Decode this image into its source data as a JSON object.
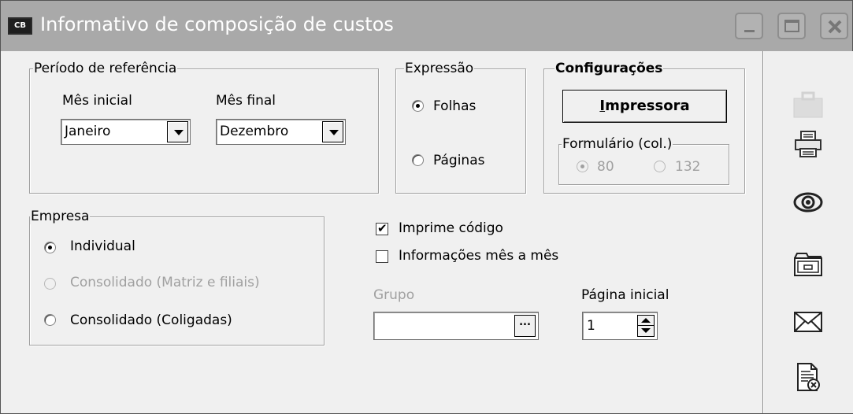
{
  "window": {
    "icon_text": "CB",
    "title": "Informativo de composição de custos"
  },
  "periodo": {
    "legend": "Período de referência",
    "mes_inicial_label": "Mês inicial",
    "mes_inicial_value": "Janeiro",
    "mes_final_label": "Mês final",
    "mes_final_value": "Dezembro"
  },
  "expressao": {
    "legend": "Expressão",
    "options": [
      {
        "label": "Folhas",
        "selected": true
      },
      {
        "label": "Páginas",
        "selected": false
      }
    ]
  },
  "configuracoes": {
    "legend": "Configurações",
    "printer_button_label": "Impressora",
    "printer_button_accel": "I",
    "printer_button_rest": "mpressora",
    "formulario": {
      "legend": "Formulário (col.)",
      "options": [
        {
          "label": "80",
          "selected": true,
          "enabled": false
        },
        {
          "label": "132",
          "selected": false,
          "enabled": false
        }
      ]
    }
  },
  "empresa": {
    "legend": "Empresa",
    "options": [
      {
        "label": "Individual",
        "selected": true,
        "enabled": true
      },
      {
        "label": "Consolidado (Matriz e filiais)",
        "selected": false,
        "enabled": false
      },
      {
        "label": "Consolidado (Coligadas)",
        "selected": false,
        "enabled": true
      }
    ]
  },
  "options": {
    "imprime_codigo": {
      "label": "Imprime código",
      "checked": true
    },
    "informacoes_mes": {
      "label": "Informações mês a mês",
      "checked": false
    }
  },
  "grupo": {
    "label": "Grupo",
    "value": "",
    "browse_label": "..."
  },
  "pagina_inicial": {
    "label": "Página inicial",
    "value": "1"
  },
  "sidebar": {
    "icons": [
      "briefcase-icon",
      "printer-icon",
      "eye-icon",
      "folder-icon",
      "envelope-icon",
      "document-cancel-icon"
    ]
  },
  "colors": {
    "titlebar": "#a9a9a9",
    "background": "#f0f0f0",
    "disabled_text": "#a0a0a0"
  }
}
